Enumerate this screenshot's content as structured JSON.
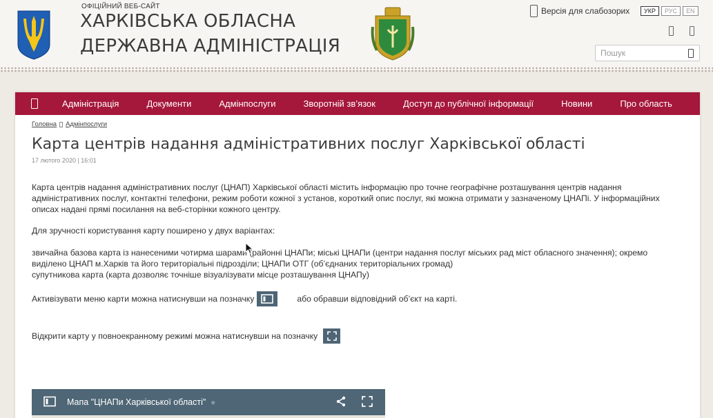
{
  "header": {
    "official_label": "ОФІЦІЙНИЙ ВЕБ-САЙТ",
    "title_line1": "ХАРКІВСЬКА ОБЛАСНА",
    "title_line2": "ДЕРЖАВНА АДМІНІСТРАЦІЯ",
    "accessibility_label": "Версія для слабозорих",
    "languages": [
      "УКР",
      "РУС",
      "EN"
    ],
    "active_language": "УКР",
    "search_placeholder": "Пошук"
  },
  "nav": {
    "items": [
      "Адміністрація",
      "Документи",
      "Адмінпослуги",
      "Зворотній зв’язок",
      "Доступ до публічної інформації",
      "Новини",
      "Про область"
    ]
  },
  "breadcrumb": [
    "Головна",
    "Адмінпослуги"
  ],
  "article": {
    "title": "Карта центрів надання адміністративних послуг Харківської області",
    "date": "17 лютого 2020 | 16:01",
    "p1": "Карта центрів надання адміністративних послуг (ЦНАП) Харківської області містить інформацію про точне географічне розташування центрів надання адміністративних послуг, контактні телефони, режим роботи кожної з установ, короткий опис послуг, які можна отримати у зазначеному ЦНАПі. У інформаційних описах надані прямі посилання на веб-сторінки кожного центру.",
    "p2": "Для зручності користування карту поширено у двух варіантах:",
    "p3a": "звичайна базова карта із нанесеними чотирма шарами (районні ЦНАПи; міські ЦНАПи (центри надання послуг міських рад міст обласного значення); окремо виділено ЦНАП м.Харків та його територіальні підрозділи; ЦНАПи ОТГ (об’єднаних територіальних громад)",
    "p3b": "супутникова карта (карта дозволяє точніше візуалізувати місце розташування ЦНАПу)",
    "p4_before": "Активізувати меню карти можна натиснувши на позначку",
    "p4_after": "або обравши відповідний об’єкт на карті.",
    "p5": "Відкрити карту у повноекранному режимі можна натиснувши на позначку"
  },
  "map": {
    "title": "Мапа \"ЦНАПи Харківської області\"",
    "star": "★"
  },
  "colors": {
    "nav_bg": "#a5173b",
    "map_bar": "#4e6675",
    "page_bg": "#eeeae4"
  }
}
